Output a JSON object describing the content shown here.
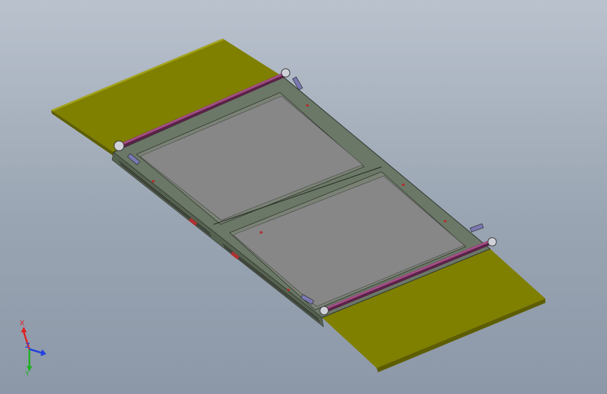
{
  "viewport": {
    "background_top": "#b9c2cd",
    "background_bottom": "#8c98a8"
  },
  "model": {
    "plate_color": "#7f7f00",
    "frame_color": "#6b7867",
    "panel_color": "#8a8a8a",
    "rod_color": "#8a3a6e",
    "cylinder_color": "#7a79b4"
  },
  "triad": {
    "x_label": "X",
    "y_label": "Y",
    "z_label": "Z",
    "x_color": "#e02020",
    "y_color": "#20b020",
    "z_color": "#2040e0"
  }
}
